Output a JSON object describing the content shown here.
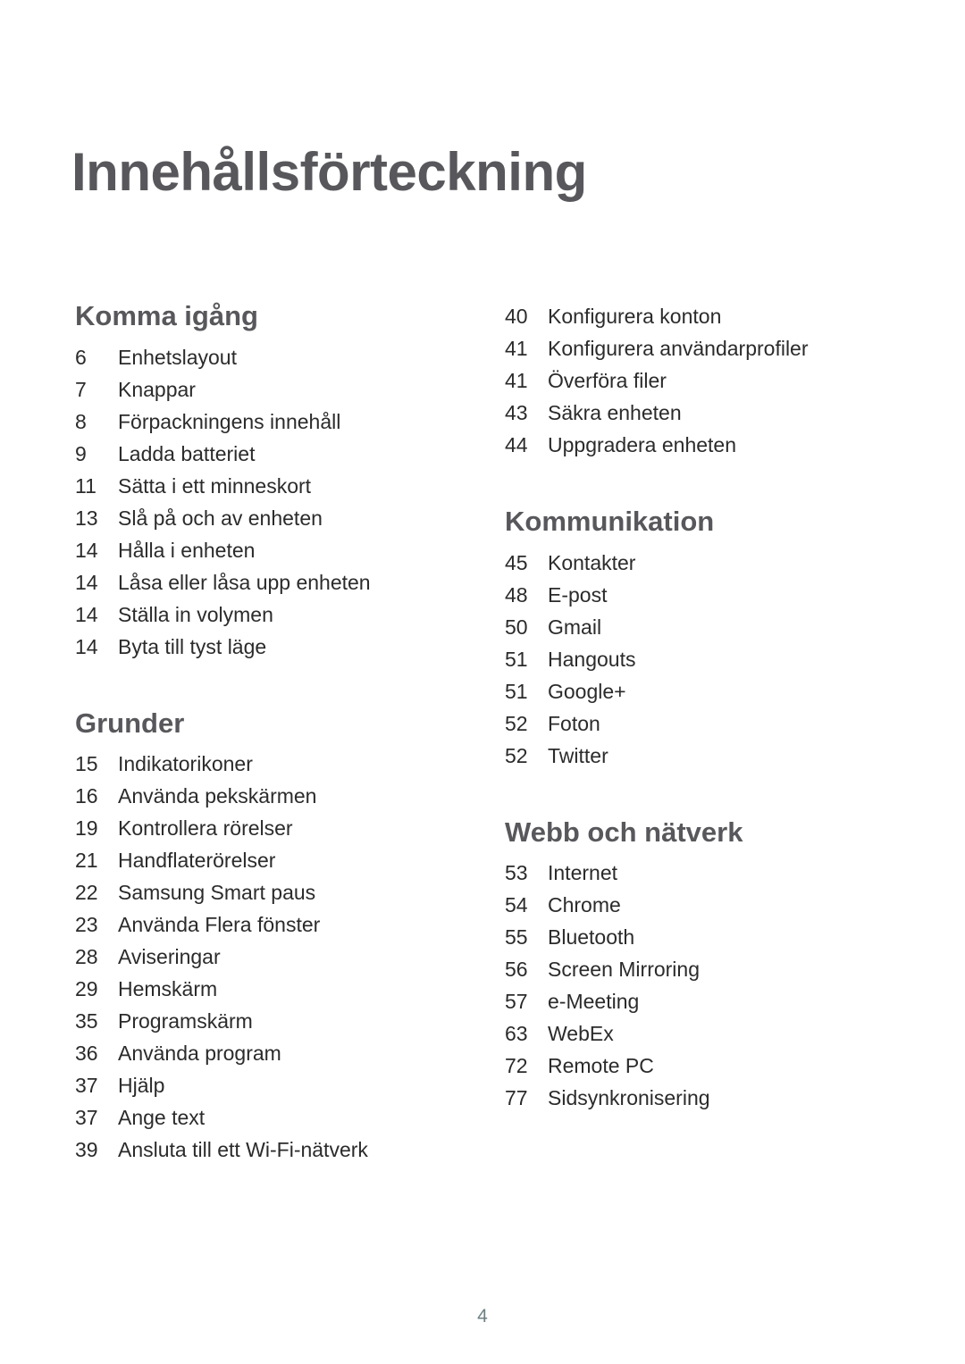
{
  "document": {
    "title": "Innehållsförteckning",
    "folio": "4"
  },
  "colors": {
    "heading": "#58585c",
    "body": "#2b2b2b",
    "folio": "#6b8084",
    "background": "#ffffff"
  },
  "columns": {
    "left": {
      "sections": [
        {
          "heading": "Komma igång",
          "has_heading": true,
          "entries": [
            {
              "page": "6",
              "label": "Enhetslayout"
            },
            {
              "page": "7",
              "label": "Knappar"
            },
            {
              "page": "8",
              "label": "Förpackningens innehåll"
            },
            {
              "page": "9",
              "label": "Ladda batteriet"
            },
            {
              "page": "11",
              "label": "Sätta i ett minneskort"
            },
            {
              "page": "13",
              "label": "Slå på och av enheten"
            },
            {
              "page": "14",
              "label": "Hålla i enheten"
            },
            {
              "page": "14",
              "label": "Låsa eller låsa upp enheten"
            },
            {
              "page": "14",
              "label": "Ställa in volymen"
            },
            {
              "page": "14",
              "label": "Byta till tyst läge"
            }
          ]
        },
        {
          "heading": "Grunder",
          "has_heading": true,
          "entries": [
            {
              "page": "15",
              "label": "Indikatorikoner"
            },
            {
              "page": "16",
              "label": "Använda pekskärmen"
            },
            {
              "page": "19",
              "label": "Kontrollera rörelser"
            },
            {
              "page": "21",
              "label": "Handflaterörelser"
            },
            {
              "page": "22",
              "label": "Samsung Smart paus"
            },
            {
              "page": "23",
              "label": "Använda Flera fönster"
            },
            {
              "page": "28",
              "label": "Aviseringar"
            },
            {
              "page": "29",
              "label": "Hemskärm"
            },
            {
              "page": "35",
              "label": "Programskärm"
            },
            {
              "page": "36",
              "label": "Använda program"
            },
            {
              "page": "37",
              "label": "Hjälp"
            },
            {
              "page": "37",
              "label": "Ange text"
            },
            {
              "page": "39",
              "label": "Ansluta till ett Wi-Fi-nätverk"
            }
          ]
        }
      ]
    },
    "right": {
      "sections": [
        {
          "heading": "",
          "has_heading": false,
          "entries": [
            {
              "page": "40",
              "label": "Konfigurera konton"
            },
            {
              "page": "41",
              "label": "Konfigurera användarprofiler"
            },
            {
              "page": "41",
              "label": "Överföra filer"
            },
            {
              "page": "43",
              "label": "Säkra enheten"
            },
            {
              "page": "44",
              "label": "Uppgradera enheten"
            }
          ]
        },
        {
          "heading": "Kommunikation",
          "has_heading": true,
          "entries": [
            {
              "page": "45",
              "label": "Kontakter"
            },
            {
              "page": "48",
              "label": "E-post"
            },
            {
              "page": "50",
              "label": "Gmail"
            },
            {
              "page": "51",
              "label": "Hangouts"
            },
            {
              "page": "51",
              "label": "Google+"
            },
            {
              "page": "52",
              "label": "Foton"
            },
            {
              "page": "52",
              "label": "Twitter"
            }
          ]
        },
        {
          "heading": "Webb och nätverk",
          "has_heading": true,
          "entries": [
            {
              "page": "53",
              "label": "Internet"
            },
            {
              "page": "54",
              "label": "Chrome"
            },
            {
              "page": "55",
              "label": "Bluetooth"
            },
            {
              "page": "56",
              "label": "Screen Mirroring"
            },
            {
              "page": "57",
              "label": "e-Meeting"
            },
            {
              "page": "63",
              "label": "WebEx"
            },
            {
              "page": "72",
              "label": "Remote PC"
            },
            {
              "page": "77",
              "label": "Sidsynkronisering"
            }
          ]
        }
      ]
    }
  }
}
